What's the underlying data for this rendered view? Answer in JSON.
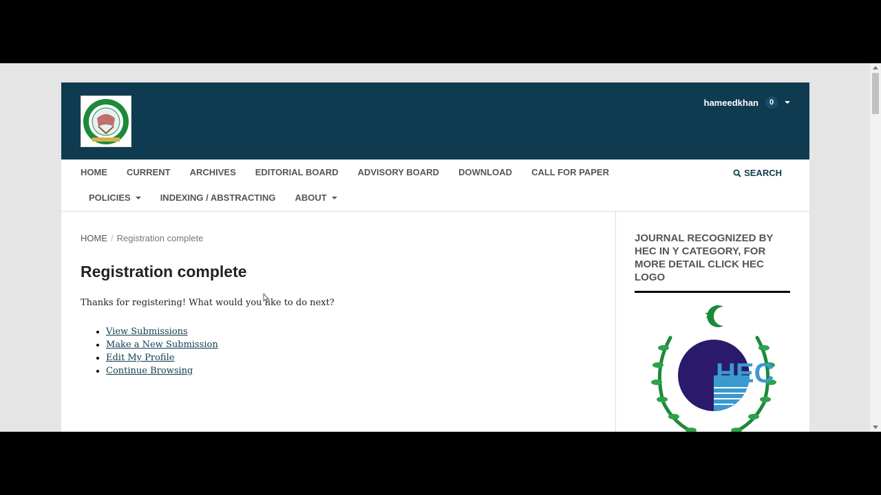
{
  "header": {
    "username": "hameedkhan",
    "notification_count": "0"
  },
  "nav": {
    "row1": [
      "HOME",
      "CURRENT",
      "ARCHIVES",
      "EDITORIAL BOARD",
      "ADVISORY BOARD",
      "DOWNLOAD",
      "CALL FOR PAPER"
    ],
    "policies": "POLICIES",
    "indexing": "INDEXING / ABSTRACTING",
    "about": "ABOUT",
    "search": "SEARCH"
  },
  "breadcrumb": {
    "home": "HOME",
    "current": "Registration complete"
  },
  "main": {
    "title": "Registration complete",
    "intro": "Thanks for registering! What would you like to do next?",
    "links": [
      "View Submissions",
      "Make a New Submission",
      "Edit My Profile",
      "Continue Browsing"
    ]
  },
  "sidebar": {
    "title": "JOURNAL RECOGNIZED BY HEC IN Y CATEGORY, FOR MORE DETAIL CLICK HEC LOGO",
    "logo_text": "HEC"
  },
  "colors": {
    "header_bg": "#0e3b4f",
    "link": "#0e3b4f"
  }
}
